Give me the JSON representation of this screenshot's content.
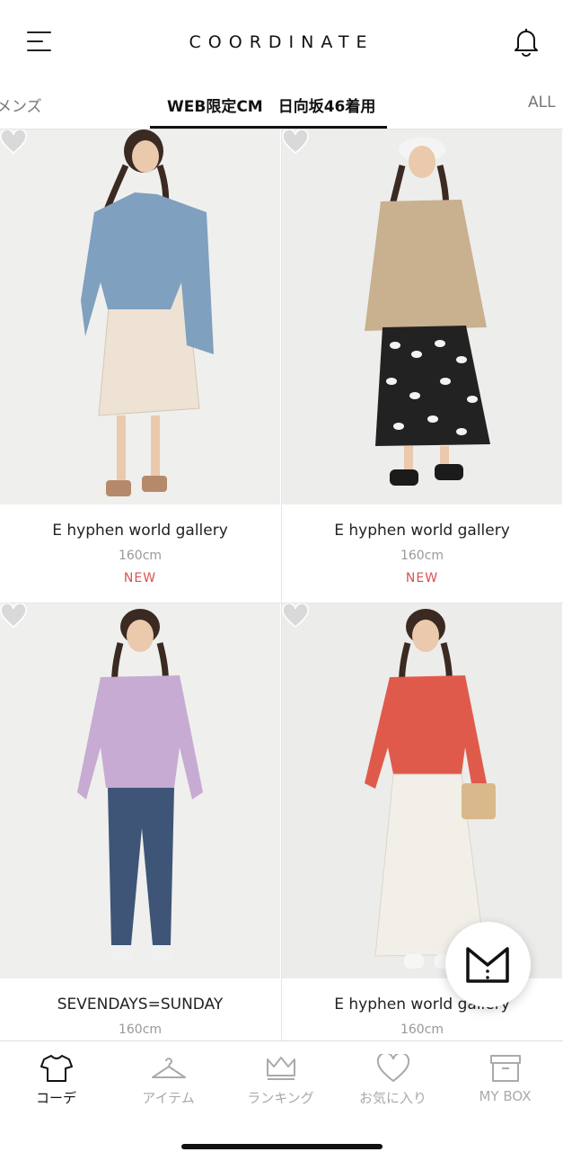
{
  "header": {
    "title": "COORDINATE"
  },
  "tabs": [
    {
      "label": "メンズ",
      "active": false
    },
    {
      "label": "WEB限定CM　日向坂46着用",
      "active": true
    },
    {
      "label": "ALL",
      "active": false
    }
  ],
  "cards": [
    {
      "brand": "E hyphen world gallery",
      "height": "160cm",
      "badge": "NEW",
      "favorited": false
    },
    {
      "brand": "E hyphen world gallery",
      "height": "160cm",
      "badge": "NEW",
      "favorited": false
    },
    {
      "brand": "SEVENDAYS=SUNDAY",
      "height": "160cm",
      "badge": "",
      "favorited": false
    },
    {
      "brand": "E hyphen world gallery",
      "height": "160cm",
      "badge": "",
      "favorited": false
    }
  ],
  "bottom_nav": [
    {
      "label": "コーデ",
      "icon": "tshirt-icon",
      "active": true
    },
    {
      "label": "アイテム",
      "icon": "hanger-icon",
      "active": false
    },
    {
      "label": "ランキング",
      "icon": "crown-icon",
      "active": false
    },
    {
      "label": "お気に入り",
      "icon": "heart-icon",
      "active": false
    },
    {
      "label": "MY BOX",
      "icon": "box-icon",
      "active": false
    }
  ],
  "colors": {
    "accent_new": "#d9534f",
    "active": "#111111",
    "inactive": "#aaaaaa"
  }
}
